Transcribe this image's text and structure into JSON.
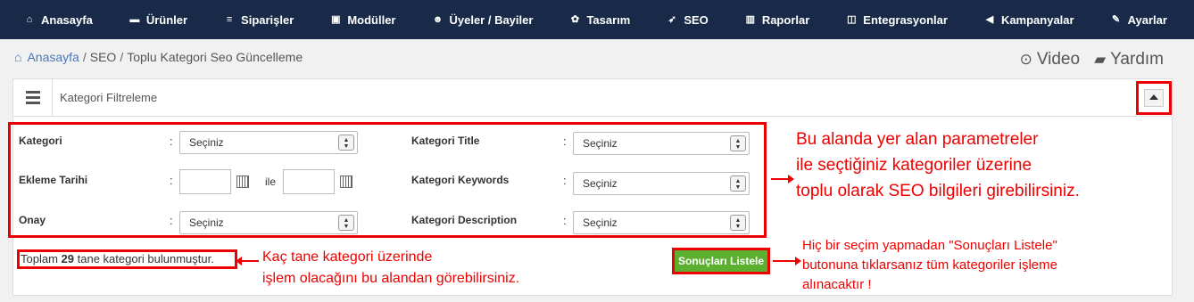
{
  "nav": [
    {
      "label": "Anasayfa",
      "icon": "home-icon",
      "glyph": "⌂"
    },
    {
      "label": "Ürünler",
      "icon": "folder-icon",
      "glyph": "▬"
    },
    {
      "label": "Siparişler",
      "icon": "list-icon",
      "glyph": "≡"
    },
    {
      "label": "Modüller",
      "icon": "plugin-icon",
      "glyph": "▣"
    },
    {
      "label": "Üyeler / Bayiler",
      "icon": "users-icon",
      "glyph": "☻"
    },
    {
      "label": "Tasarım",
      "icon": "palette-icon",
      "glyph": "✿"
    },
    {
      "label": "SEO",
      "icon": "rocket-icon",
      "glyph": "➶"
    },
    {
      "label": "Raporlar",
      "icon": "chart-icon",
      "glyph": "▥"
    },
    {
      "label": "Entegrasyonlar",
      "icon": "integration-icon",
      "glyph": "◫"
    },
    {
      "label": "Kampanyalar",
      "icon": "bullhorn-icon",
      "glyph": "◀"
    },
    {
      "label": "Ayarlar",
      "icon": "wrench-icon",
      "glyph": "✎"
    }
  ],
  "breadcrumb": {
    "home": "Anasayfa",
    "sep": "/",
    "items": [
      "SEO",
      "Toplu Kategori Seo Güncelleme"
    ]
  },
  "help": {
    "video": "Video",
    "yardim": "Yardım"
  },
  "panel": {
    "title": "Kategori Filtreleme"
  },
  "filters": {
    "kategori": {
      "label": "Kategori",
      "value": "Seçiniz"
    },
    "ekleme_tarihi": {
      "label": "Ekleme Tarihi",
      "between": "ile"
    },
    "onay": {
      "label": "Onay",
      "value": "Seçiniz"
    },
    "kategori_title": {
      "label": "Kategori Title",
      "value": "Seçiniz"
    },
    "kategori_keywords": {
      "label": "Kategori Keywords",
      "value": "Seçiniz"
    },
    "kategori_description": {
      "label": "Kategori Description",
      "value": "Seçiniz"
    },
    "colon": ":"
  },
  "total": {
    "prefix": "Toplam",
    "count": "29",
    "suffix": "tane kategori bulunmuştur."
  },
  "list_button": "Sonuçları Listele",
  "annotations": {
    "params": [
      "Bu alanda yer alan parametreler",
      "ile seçtiğiniz kategoriler üzerine",
      "toplu olarak SEO bilgileri girebilirsiniz."
    ],
    "count": [
      "Kaç tane kategori üzerinde",
      "işlem olacağını bu alandan görebilirsiniz."
    ],
    "button": [
      "Hiç bir seçim yapmadan \"Sonuçları Listele\"",
      "butonuna tıklarsanız tüm kategoriler işleme",
      "alınacaktır !"
    ]
  },
  "colors": {
    "nav_bg": "#182a48",
    "highlight": "#e00000",
    "button": "#5cb030",
    "link": "#4a78b8"
  }
}
